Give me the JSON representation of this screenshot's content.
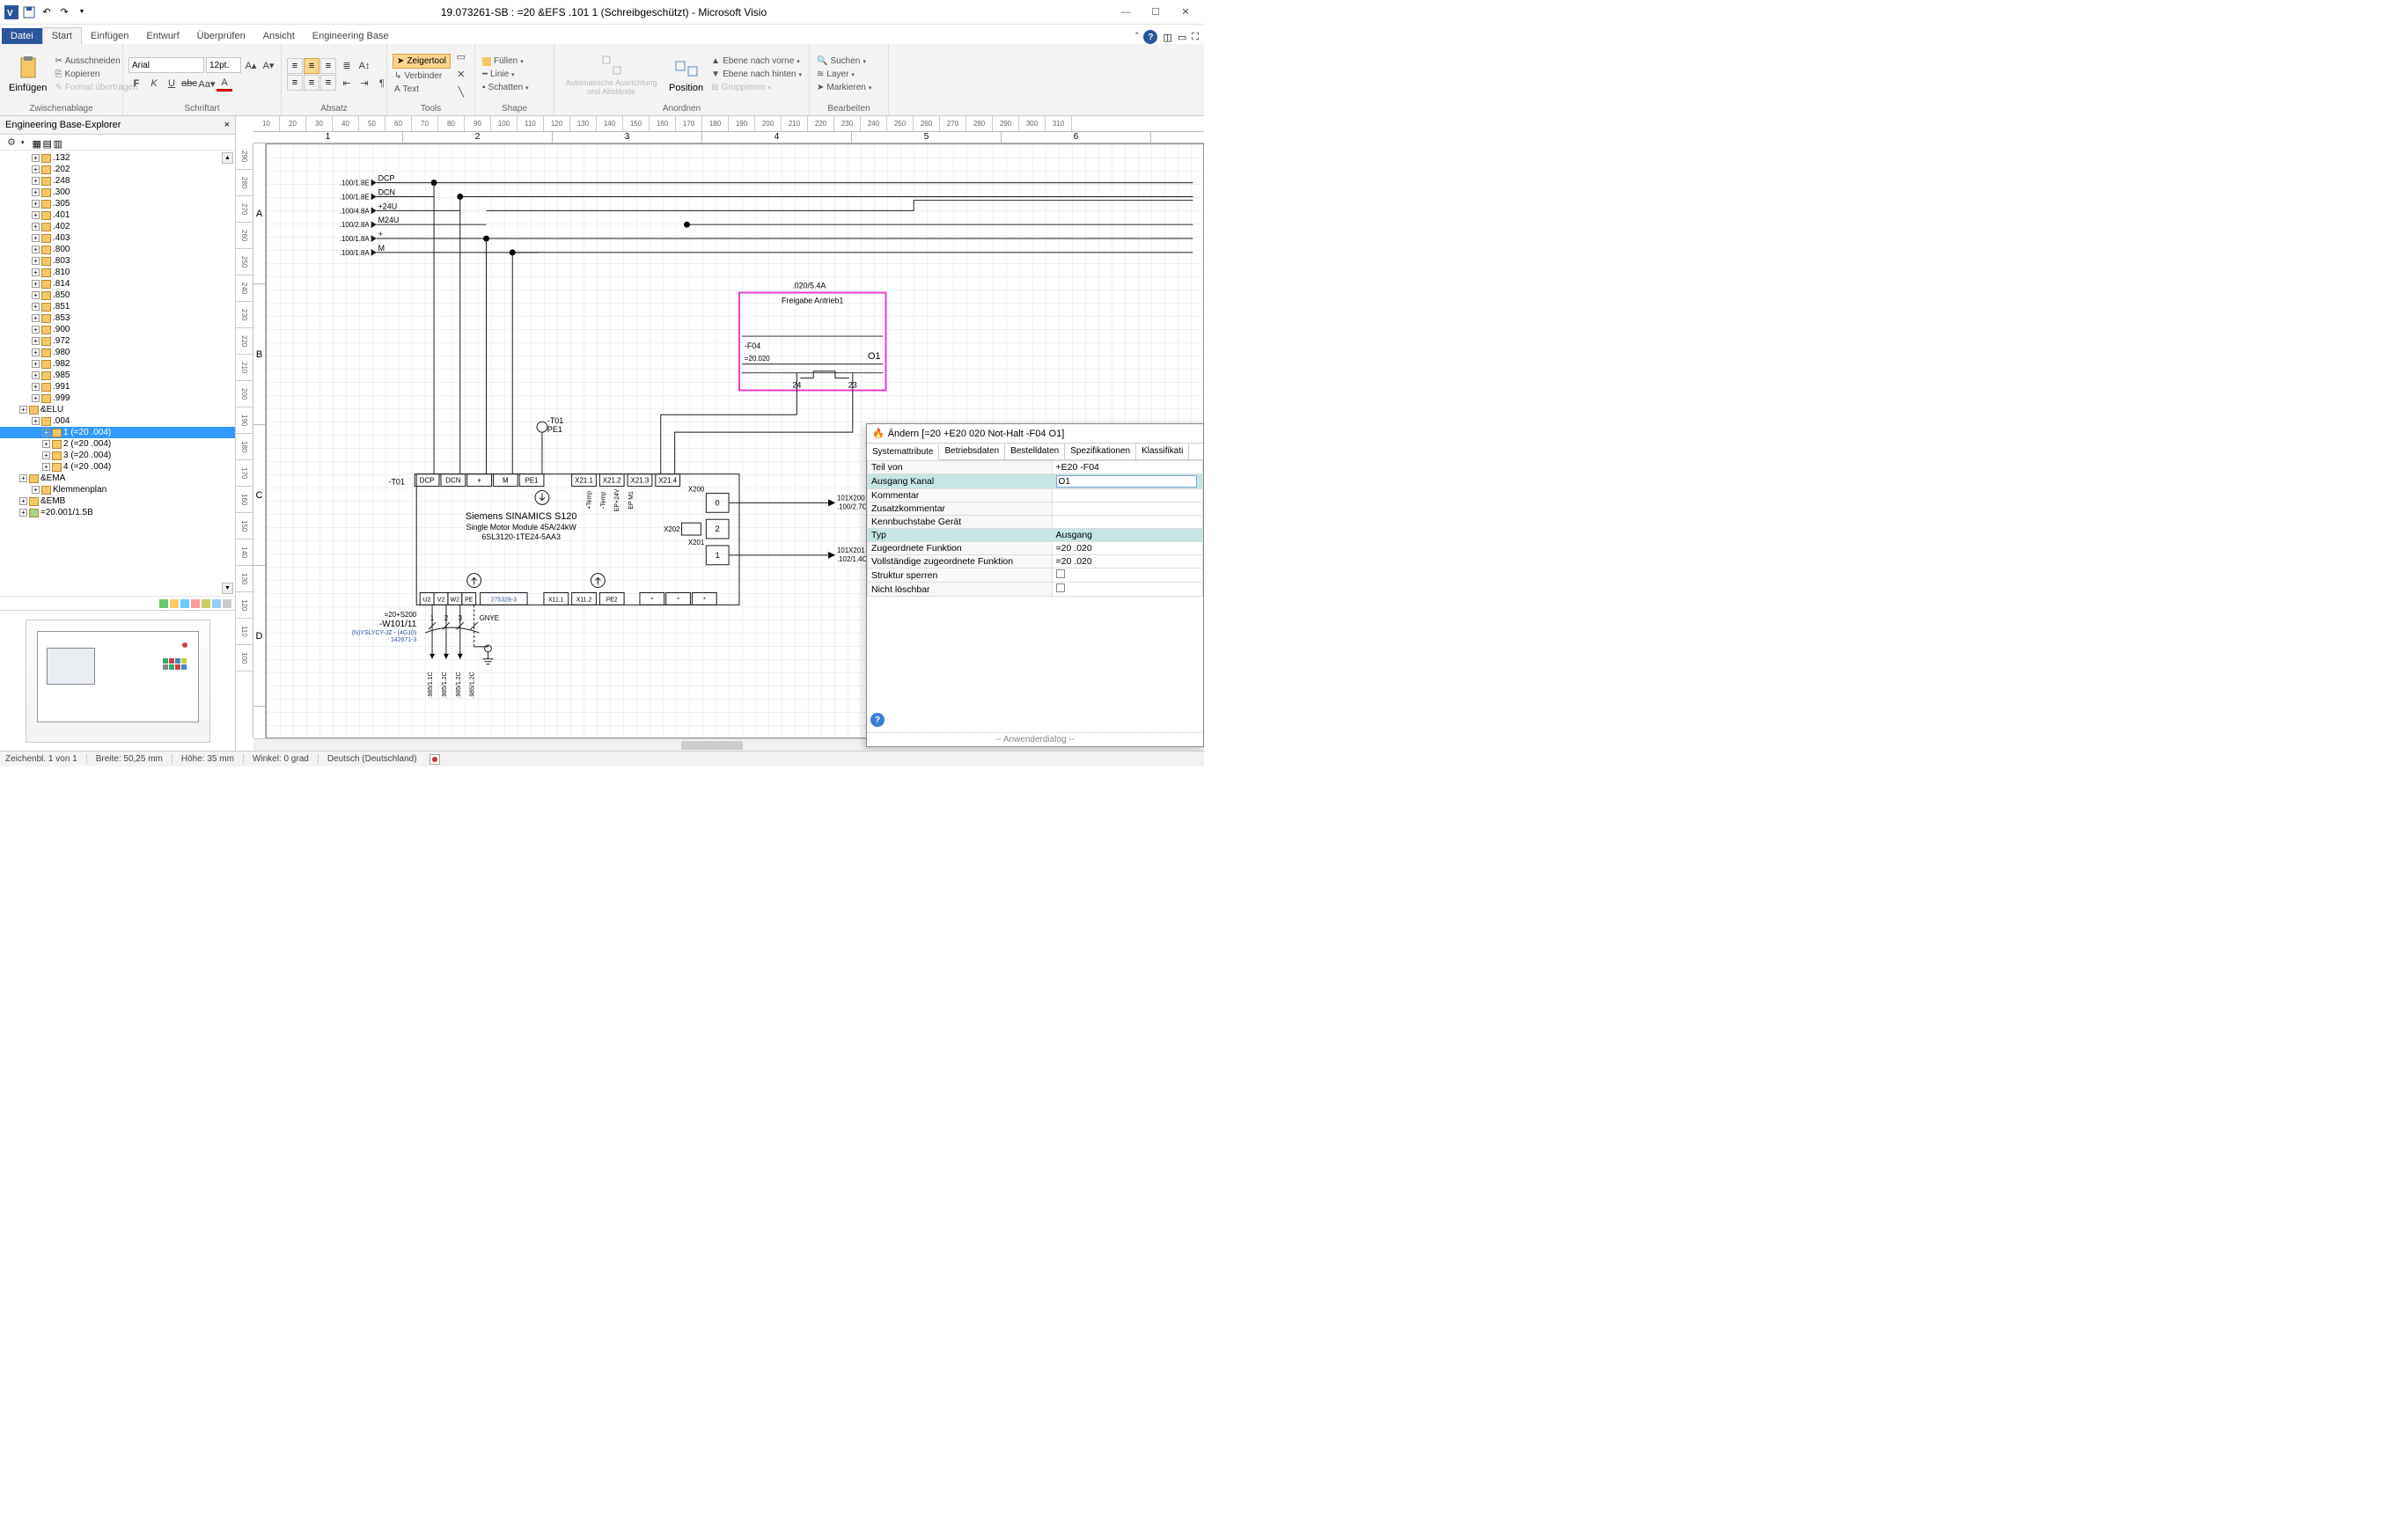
{
  "title": "19.073261-SB : =20 &EFS .101 1 (Schreibgeschützt) - Microsoft Visio",
  "ribbon": {
    "file": "Datei",
    "tabs": [
      "Start",
      "Einfügen",
      "Entwurf",
      "Überprüfen",
      "Ansicht",
      "Engineering Base"
    ],
    "active": 0,
    "group_clipboard": "Zwischenablage",
    "paste": "Einfügen",
    "cut": "Ausschneiden",
    "copy": "Kopieren",
    "format_painter": "Format übertragen",
    "group_font": "Schriftart",
    "font_name": "Arial",
    "font_size": "12pt.",
    "group_paragraph": "Absatz",
    "group_tools": "Tools",
    "pointer": "Zeigertool",
    "connector": "Verbinder",
    "text": "Text",
    "group_shape": "Shape",
    "fill": "Füllen",
    "line": "Linie",
    "shadow": "Schatten",
    "group_arrange": "Anordnen",
    "align_label": "Automatische Ausrichtung und Abstände",
    "position": "Position",
    "bring_forward": "Ebene nach vorne",
    "send_backward": "Ebene nach hinten",
    "group_btn": "Gruppieren",
    "group_edit": "Bearbeiten",
    "find": "Suchen",
    "layer": "Layer",
    "select": "Markieren"
  },
  "explorer": {
    "title": "Engineering Base-Explorer",
    "items_top": [
      ".132",
      ".202",
      ".248",
      ".300",
      ".305",
      ".401",
      ".402",
      ".403",
      ".800",
      ".803",
      ".810",
      ".814",
      ".850",
      ".851",
      ".853",
      ".900",
      ".972",
      ".980",
      ".982",
      ".985",
      ".991",
      ".999"
    ],
    "elu": "&ELU",
    "elu_004": ".004",
    "elu_children": [
      "1  (=20 .004)",
      "2  (=20 .004)",
      "3  (=20 .004)",
      "4  (=20 .004)"
    ],
    "ema": "&EMA",
    "klemmenplan": "Klemmenplan",
    "emb": "&EMB",
    "last": "=20.001/1.5B"
  },
  "ruler_minor": [
    "10",
    "20",
    "30",
    "40",
    "50",
    "60",
    "70",
    "80",
    "90",
    "100",
    "110",
    "120",
    "130",
    "140",
    "150",
    "160",
    "170",
    "180",
    "190",
    "200",
    "210",
    "220",
    "230",
    "240",
    "250",
    "260",
    "270",
    "280",
    "290",
    "300",
    "310"
  ],
  "ruler_major": [
    "1",
    "2",
    "3",
    "4",
    "5",
    "6"
  ],
  "ruler_v": [
    "290",
    "280",
    "270",
    "260",
    "250",
    "240",
    "230",
    "220",
    "210",
    "200",
    "190",
    "180",
    "170",
    "160",
    "150",
    "140",
    "130",
    "120",
    "110",
    "100"
  ],
  "rows": [
    "A",
    "B",
    "C",
    "D"
  ],
  "schematic": {
    "refs": [
      ".100/1.8E",
      ".100/1.8E",
      ".100/4.8A",
      ".100/2.8A",
      ".100/1.8A",
      ".100/1.8A"
    ],
    "signals": [
      "DCP",
      "DCN",
      "+24U",
      "M24U",
      "+",
      "M"
    ],
    "box_ref": ".020/5.4A",
    "box_title": "Freigabe Antrieb1",
    "box_tag": "-F04",
    "box_eq": "=20.020",
    "box_channel": "O1",
    "box_pin_l": "24",
    "box_pin_r": "23",
    "t01": "-T01",
    "t01_pe": "PE1",
    "device_title": "Siemens SINAMICS S120",
    "device_sub1": "Single Motor Module 45A/24kW",
    "device_sub2": "6SL3120-1TE24-5AA3",
    "dev_top": [
      "DCP",
      "DCN",
      "+",
      "M",
      "PE1",
      "X21.1",
      "X21.2",
      "X21.3",
      "X21.4"
    ],
    "dev_bot": [
      "U2",
      "V2",
      "W2",
      "PE",
      "275328-3",
      "X11.1",
      "X11.2",
      "PE2",
      "*",
      "*",
      "*"
    ],
    "dev_side_top": [
      "+Temp",
      "-Temp",
      "EP+24V",
      "EP M1"
    ],
    "x200": "X200",
    "x201": "X201",
    "x202": "X202",
    "port0": "0",
    "port1": "1",
    "port2": "2",
    "ref_101x200": "101X200",
    "ref_100_27c": ".100/2.7C",
    "ref_101x201": "101X201",
    "ref_102_14c": ".102/1.4C",
    "cable_tag": "=20+S200",
    "cable_w": "-W101/11",
    "cable_type": "(N)YSLYCY-JZ - (4G10)",
    "cable_no": "142671-3",
    "cores": [
      "1",
      "2",
      "3"
    ],
    "gnye": "GNYE",
    "bot_refs": [
      ".985/1.1C",
      ".985/1.2C",
      ".985/1.2C",
      ".985/1.2C"
    ]
  },
  "dialog": {
    "title": "Ändern [=20 +E20 020 Not-Halt -F04 O1]",
    "tabs": [
      "Systemattribute",
      "Betriebsdaten",
      "Bestelldaten",
      "Spezifikationen",
      "Klassifikati"
    ],
    "rows": [
      [
        "Teil von",
        "+E20 -F04"
      ],
      [
        "Ausgang Kanal",
        "O1"
      ],
      [
        "Kommentar",
        ""
      ],
      [
        "Zusatzkommentar",
        ""
      ],
      [
        "Kennbuchstabe Gerät",
        ""
      ],
      [
        "Typ",
        "Ausgang"
      ],
      [
        "Zugeordnete Funktion",
        "=20 .020"
      ],
      [
        "Vollständige zugeordnete Funktion",
        "=20 .020"
      ],
      [
        "Struktur sperren",
        "[]"
      ],
      [
        "Nicht löschbar",
        "[]"
      ]
    ],
    "footer": "-- Anwenderdialog --"
  },
  "status": {
    "page": "Zeichenbl. 1 von 1",
    "width": "Breite: 50,25 mm",
    "height": "Höhe: 35 mm",
    "angle": "Winkel: 0 grad",
    "lang": "Deutsch (Deutschland)"
  }
}
